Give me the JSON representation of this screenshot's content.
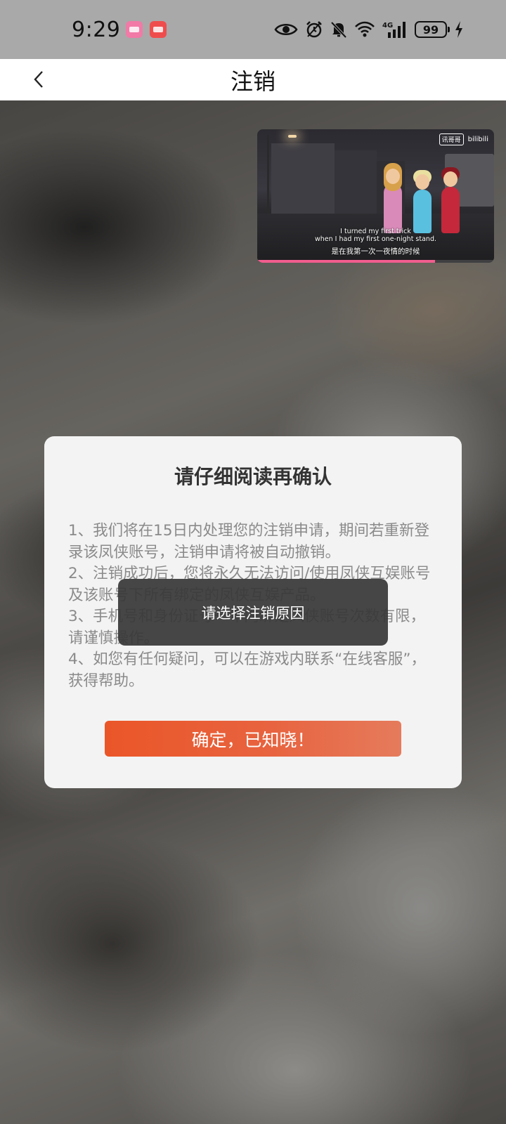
{
  "status_bar": {
    "time": "9:29",
    "app_icons": [
      "bilibili-icon",
      "store-icon"
    ],
    "icons": [
      "eye-icon",
      "alarm-icon",
      "mute-icon",
      "wifi-icon",
      "signal-4g-icon",
      "battery-icon",
      "charging-icon"
    ],
    "network": "4G",
    "battery": "99"
  },
  "nav": {
    "title": "注销"
  },
  "video": {
    "logo": "bilibili",
    "tv_badge": "讯哥哥",
    "subtitle_en": "I turned my first trick\nwhen I had my first one-night stand.",
    "subtitle_zh": "是在我第一次一夜情的时候",
    "progress": 0.75
  },
  "dialog": {
    "title": "请仔细阅读再确认",
    "paragraphs": [
      "1、我们将在15日内处理您的注销申请，期间若重新登录该凤侠账号，注销申请将被自动撤销。",
      "2、注销成功后，您将永久无法访问/使用凤侠互娱账号及该账号下所有绑定的凤侠互娱产品。",
      "3、手机号和身份证号一年内绑定凤侠账号次数有限，请谨慎操作。",
      "4、如您有任何疑问，可以在游戏内联系“在线客服”，获得帮助。"
    ],
    "confirm_label": "确定，已知晓！"
  },
  "toast": {
    "message": "请选择注销原因"
  },
  "colors": {
    "accent": "#ea5628",
    "status_bar_bg": "#a9a9a9",
    "dialog_bg": "#f3f3f3",
    "toast_bg": "#373737"
  }
}
